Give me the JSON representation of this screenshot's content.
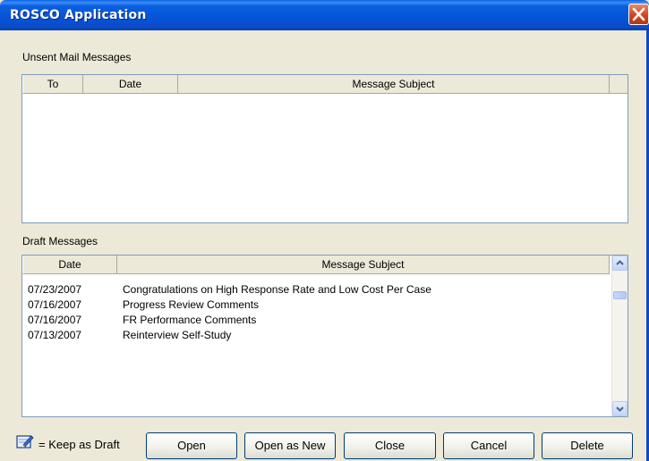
{
  "window": {
    "title": "ROSCO Application"
  },
  "unsent": {
    "label": "Unsent Mail Messages",
    "columns": [
      "To",
      "Date",
      "Message Subject"
    ],
    "rows": []
  },
  "drafts": {
    "label": "Draft Messages",
    "columns": [
      "Date",
      "Message Subject"
    ],
    "rows": [
      {
        "date": "07/23/2007",
        "subject": "Congratulations on High Response Rate and Low Cost Per Case"
      },
      {
        "date": "07/16/2007",
        "subject": "Progress Review Comments"
      },
      {
        "date": "07/16/2007",
        "subject": "FR Performance Comments"
      },
      {
        "date": "07/13/2007",
        "subject": "Reinterview Self-Study"
      }
    ]
  },
  "legend": {
    "icon": "draft-pencil-icon",
    "text": "= Keep as Draft"
  },
  "buttons": {
    "open": "Open",
    "open_as_new": "Open as New",
    "close": "Close",
    "cancel": "Cancel",
    "delete": "Delete"
  }
}
